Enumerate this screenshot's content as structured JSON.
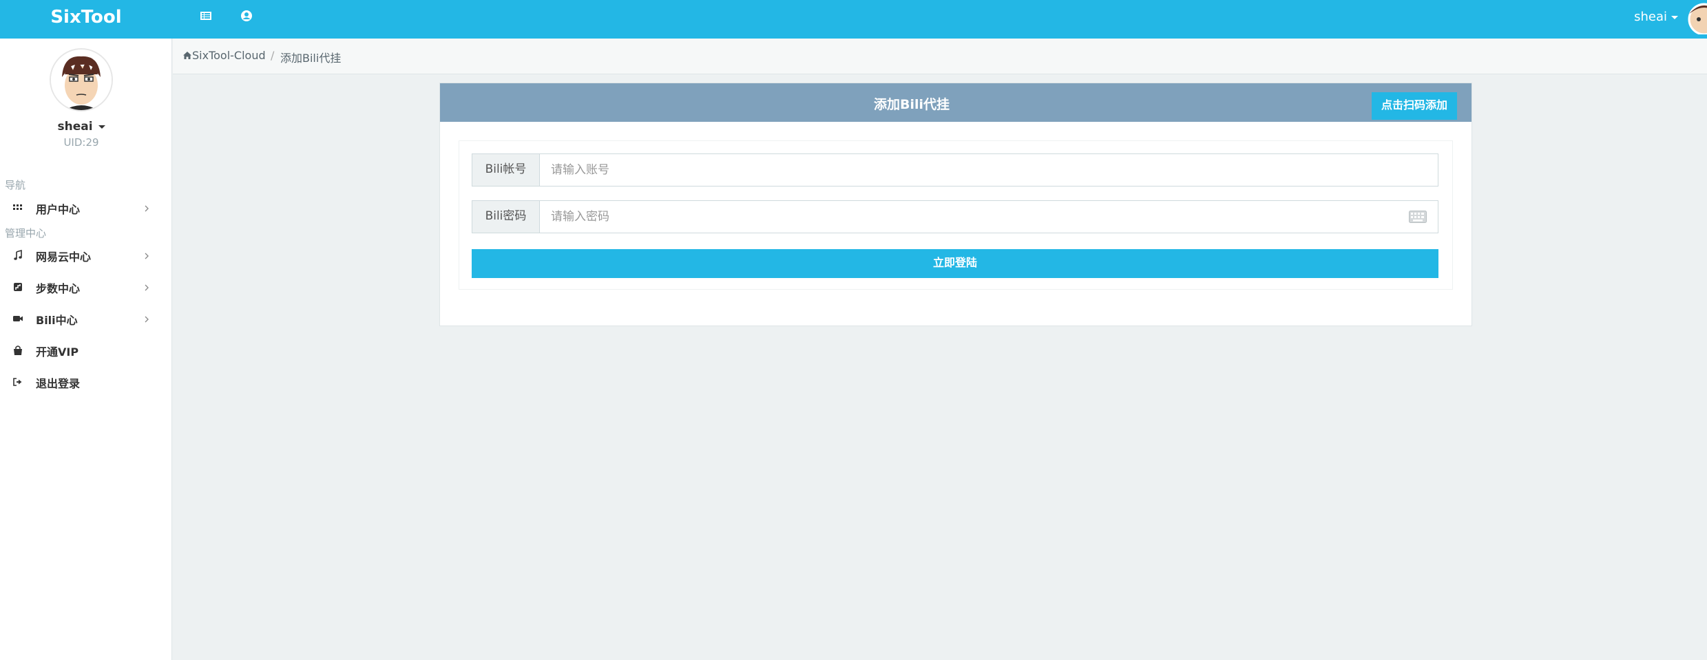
{
  "header": {
    "brand": "SixTool",
    "icons": [
      "list-icon",
      "user-circle-icon"
    ],
    "username": "sheai"
  },
  "sidebar": {
    "username": "sheai",
    "uid": "UID:29",
    "sections": {
      "nav": "导航",
      "admin": "管理中心"
    },
    "items": [
      {
        "label": "用户中心",
        "icon": "grid-icon",
        "chevron": true
      },
      {
        "label": "网易云中心",
        "icon": "music-icon",
        "chevron": true
      },
      {
        "label": "步数中心",
        "icon": "steps-icon",
        "chevron": true
      },
      {
        "label": "Bili中心",
        "icon": "video-camera-icon",
        "chevron": true
      },
      {
        "label": "开通VIP",
        "icon": "shopping-bag-icon",
        "chevron": false
      },
      {
        "label": "退出登录",
        "icon": "sign-out-icon",
        "chevron": false
      }
    ]
  },
  "breadcrumb": {
    "home": "SixTool-Cloud",
    "separator": "/",
    "current": "添加Bili代挂"
  },
  "panel": {
    "title": "添加Bili代挂",
    "scan_button": "点击扫码添加",
    "account_label": "Bili帐号",
    "account_placeholder": "请输入账号",
    "password_label": "Bili密码",
    "password_placeholder": "请输入密码",
    "login_button": "立即登陆"
  },
  "colors": {
    "primary": "#23b7e5",
    "panel_header": "#7fa1bc",
    "background": "#edf1f2"
  }
}
